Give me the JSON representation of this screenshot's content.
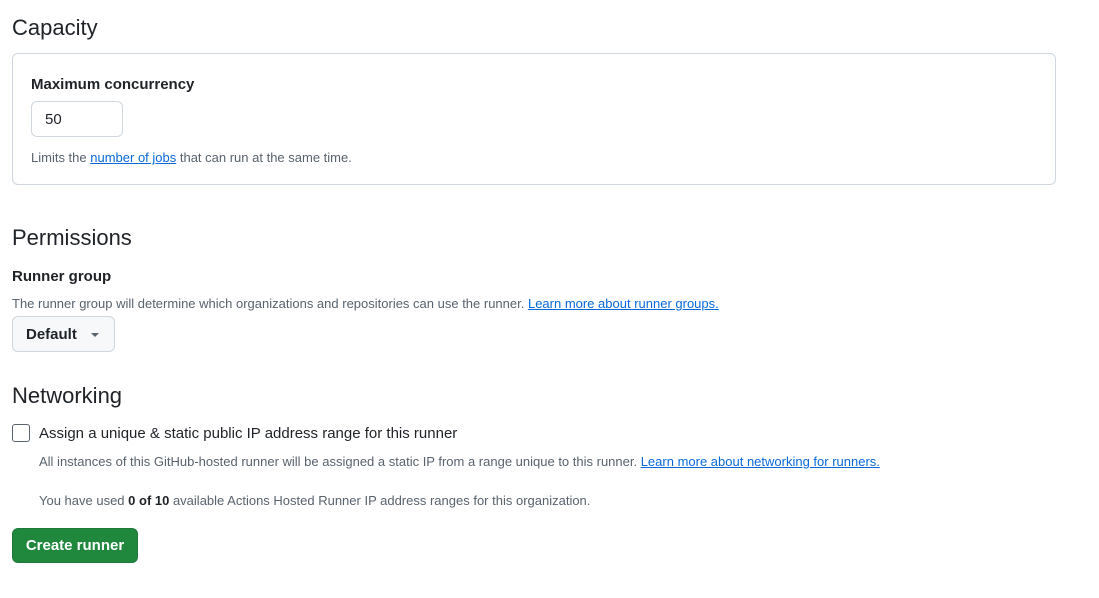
{
  "capacity": {
    "title": "Capacity",
    "max_concurrency_label": "Maximum concurrency",
    "max_concurrency_value": "50",
    "hint_prefix": "Limits the ",
    "hint_link": "number of jobs",
    "hint_suffix": " that can run at the same time."
  },
  "permissions": {
    "title": "Permissions",
    "runner_group_label": "Runner group",
    "runner_group_hint": "The runner group will determine which organizations and repositories can use the runner. ",
    "runner_group_link": "Learn more about runner groups.",
    "runner_group_selected": "Default"
  },
  "networking": {
    "title": "Networking",
    "checkbox_label": "Assign a unique & static public IP address range for this runner",
    "checkbox_checked": false,
    "hint": "All instances of this GitHub-hosted runner will be assigned a static IP from a range unique to this runner. ",
    "hint_link": "Learn more about networking for runners.",
    "usage_prefix": "You have used ",
    "usage_count": "0 of 10",
    "usage_suffix": " available Actions Hosted Runner IP address ranges for this organization."
  },
  "actions": {
    "create_label": "Create runner"
  },
  "colors": {
    "primary_button": "#1f883d",
    "link": "#0969da",
    "border": "#d0d7de",
    "muted_text": "#59636e"
  },
  "icons": {
    "dropdown": "triangle-down-icon"
  }
}
